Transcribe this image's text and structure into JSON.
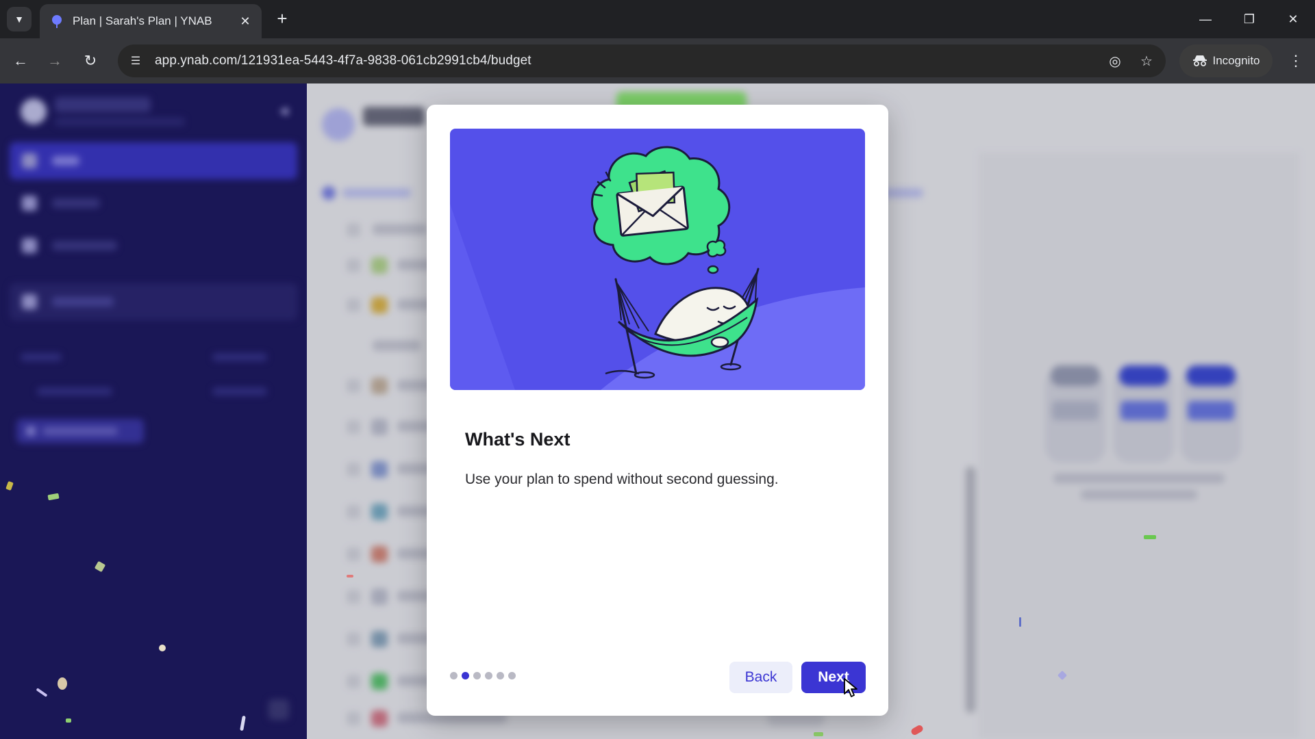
{
  "browser": {
    "tab_title": "Plan | Sarah's Plan | YNAB",
    "url": "app.ynab.com/121931ea-5443-4f7a-9838-061cb2991cb4/budget",
    "incognito_label": "Incognito"
  },
  "modal": {
    "title": "What's Next",
    "body": "Use your plan to spend without second guessing.",
    "back_label": "Back",
    "next_label": "Next",
    "steps_total": 6,
    "current_step": 2
  },
  "colors": {
    "accent": "#3b35d3",
    "hero_bg": "#5450ea",
    "sidebar_bg": "#1c1860",
    "cloud_green": "#3ee28c"
  }
}
